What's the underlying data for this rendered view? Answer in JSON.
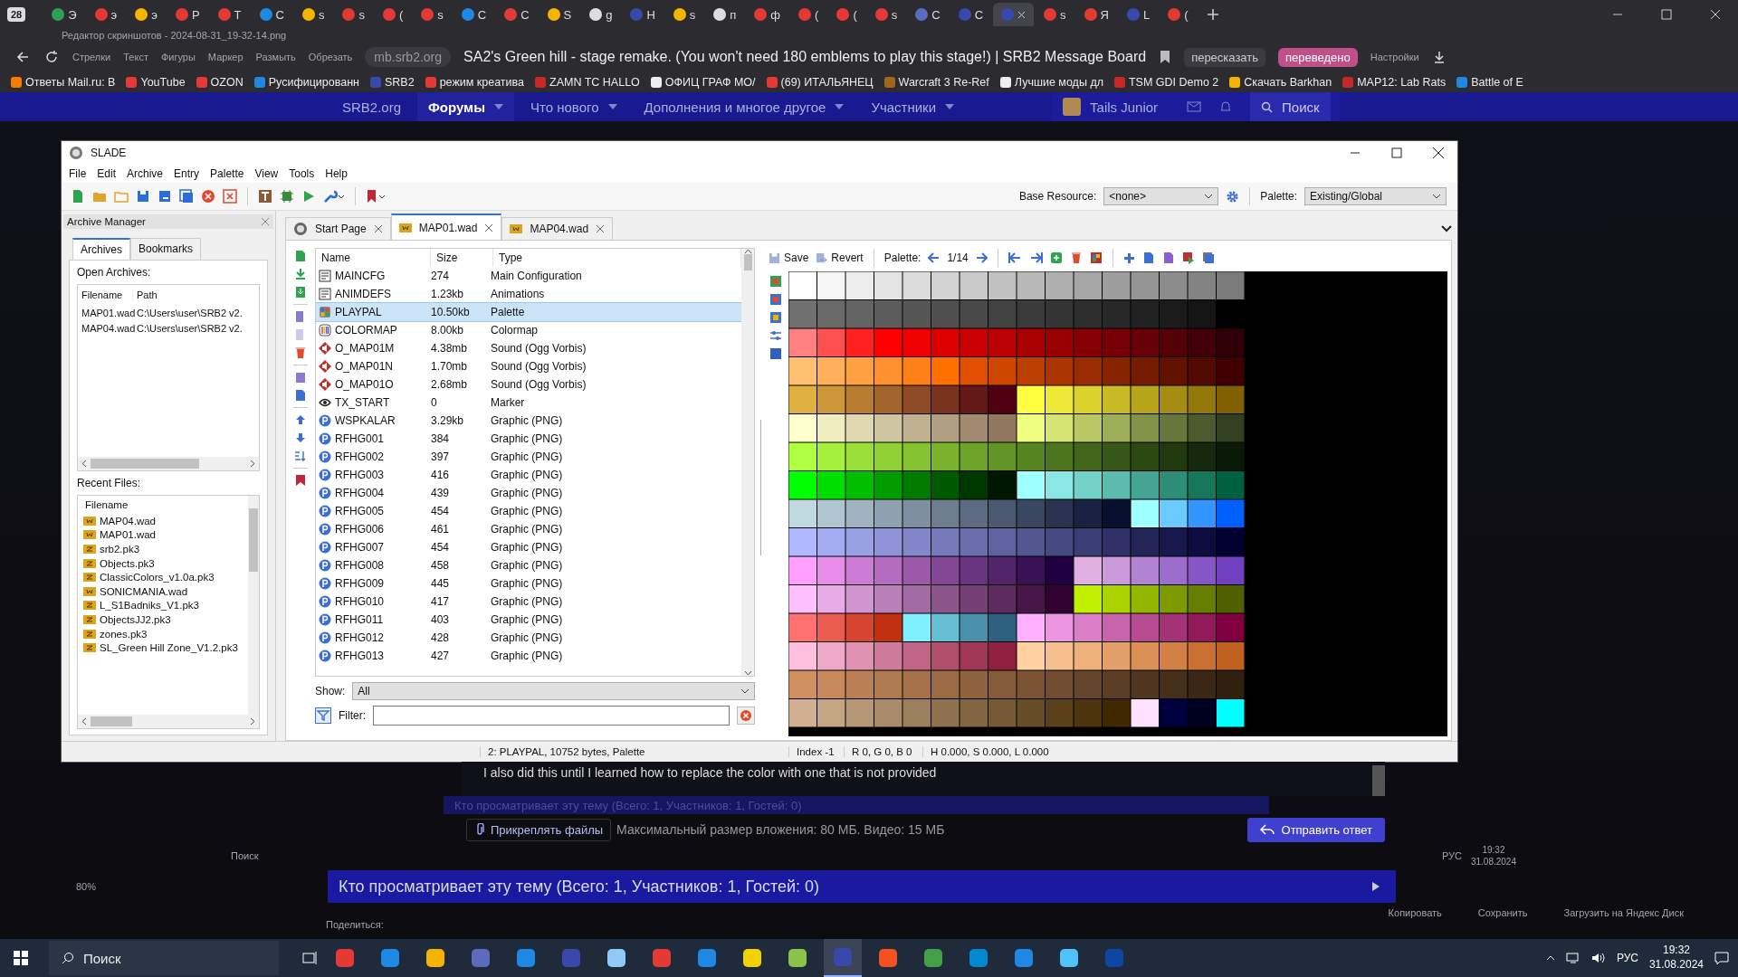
{
  "browser": {
    "tab_count": "28",
    "tabs": [
      {
        "label": "Э",
        "selected": false,
        "color": "#2e9e4f"
      },
      {
        "label": "э",
        "selected": false,
        "color": "#e53935"
      },
      {
        "label": "э",
        "selected": false,
        "color": "#f4b400"
      },
      {
        "label": "Р",
        "selected": false,
        "color": "#e53935"
      },
      {
        "label": "Т",
        "selected": false,
        "color": "#e53935"
      },
      {
        "label": "С",
        "selected": false,
        "color": "#1e88e5"
      },
      {
        "label": "s",
        "selected": false,
        "color": "#f4b400"
      },
      {
        "label": "s",
        "selected": false,
        "color": "#e53935"
      },
      {
        "label": "(",
        "selected": false,
        "color": "#e53935"
      },
      {
        "label": "s",
        "selected": false,
        "color": "#e53935"
      },
      {
        "label": "С",
        "selected": false,
        "color": "#1e88e5"
      },
      {
        "label": "С",
        "selected": false,
        "color": "#e53935"
      },
      {
        "label": "S",
        "selected": false,
        "color": "#f4b400"
      },
      {
        "label": "g",
        "selected": false,
        "color": "#dddddd"
      },
      {
        "label": "Н",
        "selected": false,
        "color": "#3949ab"
      },
      {
        "label": "s",
        "selected": false,
        "color": "#f4b400"
      },
      {
        "label": "п",
        "selected": false,
        "color": "#dddddd"
      },
      {
        "label": "ф",
        "selected": false,
        "color": "#e53935"
      },
      {
        "label": "(",
        "selected": false,
        "color": "#e53935"
      },
      {
        "label": "(",
        "selected": false,
        "color": "#e53935"
      },
      {
        "label": "s",
        "selected": false,
        "color": "#e53935"
      },
      {
        "label": "С",
        "selected": false,
        "color": "#5c6bc0"
      },
      {
        "label": "С",
        "selected": false,
        "color": "#3949ab"
      },
      {
        "selected": true,
        "color": "#3949ab"
      },
      {
        "label": "s",
        "selected": false,
        "color": "#e53935"
      },
      {
        "label": "Я",
        "selected": false,
        "color": "#e53935"
      },
      {
        "label": "L",
        "selected": false,
        "color": "#3949ab"
      },
      {
        "label": "(",
        "selected": false,
        "color": "#e53935"
      }
    ],
    "editor_title": "Редактор скриншотов - 2024-08-31_19-32-14.png",
    "editor_tools": [
      "Стрелки",
      "Текст",
      "Фигуры",
      "Маркер",
      "Размыть",
      "Обрезать"
    ],
    "editor_settings": "Настройки",
    "url": "mb.srb2.org",
    "page_title": "SA2's Green hill - stage remake. (You won't need 180 emblems to play this stage!) | SRB2 Message Board",
    "summarize": "пересказать",
    "translated": "переведено",
    "bookmarks": [
      {
        "label": "Ответы Mail.ru: B",
        "color": "#f57c00"
      },
      {
        "label": "YouTube",
        "color": "#e53935"
      },
      {
        "label": "OZON",
        "color": "#e53935"
      },
      {
        "label": "Русифицированн",
        "color": "#1e88e5"
      },
      {
        "label": "SRB2",
        "color": "#3949ab"
      },
      {
        "label": "режим креатива",
        "color": "#e53935"
      },
      {
        "label": "ZAMN TC HALLO",
        "color": "#c62828"
      },
      {
        "label": "ОФИЦ ГРАФ МО/",
        "color": "#eeeeee"
      },
      {
        "label": "(69) ИТАЛЬЯНЕЦ",
        "color": "#e53935"
      },
      {
        "label": "Warcraft 3 Re-Ref",
        "color": "#a1661a"
      },
      {
        "label": "Лучшие моды дл",
        "color": "#eeeeee"
      },
      {
        "label": "TSM GDI Demo 2",
        "color": "#c62828"
      },
      {
        "label": "Скачать Barkhan",
        "color": "#f4b400"
      },
      {
        "label": "MAP12: Lab Rats",
        "color": "#c62828"
      },
      {
        "label": "Battle of E",
        "color": "#1e88e5"
      }
    ]
  },
  "site_nav": {
    "items": [
      {
        "label": "SRB2.org",
        "selected": false,
        "menu": false
      },
      {
        "label": "Форумы",
        "selected": true,
        "menu": true
      },
      {
        "label": "Что нового",
        "selected": false,
        "menu": true
      },
      {
        "label": "Дополнения и многое другое",
        "selected": false,
        "menu": true
      },
      {
        "label": "Участники",
        "selected": false,
        "menu": true
      }
    ],
    "user": "Tails Junior",
    "search": "Поиск"
  },
  "slade": {
    "title": "SLADE",
    "menu": [
      "File",
      "Edit",
      "Archive",
      "Entry",
      "Palette",
      "View",
      "Tools",
      "Help"
    ],
    "base_resource_label": "Base Resource:",
    "base_resource": "<none>",
    "palette_label": "Palette:",
    "palette": "Existing/Global",
    "archive_manager": {
      "title": "Archive Manager",
      "tabs": [
        {
          "label": "Archives",
          "selected": true
        },
        {
          "label": "Bookmarks",
          "selected": false
        }
      ],
      "open_label": "Open Archives:",
      "open_columns": [
        "Filename",
        "Path"
      ],
      "open_rows": [
        [
          "MAP01.wad",
          "C:\\Users\\user\\SRB2 v2."
        ],
        [
          "MAP04.wad",
          "C:\\Users\\user\\SRB2 v2."
        ]
      ],
      "recent_label": "Recent Files:",
      "recent_column": "Filename",
      "recent": [
        {
          "name": "MAP04.wad",
          "kind": "wad"
        },
        {
          "name": "MAP01.wad",
          "kind": "wad"
        },
        {
          "name": "srb2.pk3",
          "kind": "zip"
        },
        {
          "name": "Objects.pk3",
          "kind": "zip"
        },
        {
          "name": "ClassicColors_v1.0a.pk3",
          "kind": "zip"
        },
        {
          "name": "SONICMANIA.wad",
          "kind": "wad"
        },
        {
          "name": "L_S1Badniks_V1.pk3",
          "kind": "zip"
        },
        {
          "name": "ObjectsJJ2.pk3",
          "kind": "zip"
        },
        {
          "name": "zones.pk3",
          "kind": "zip"
        },
        {
          "name": "SL_Green Hill Zone_V1.2.pk3",
          "kind": "zip"
        }
      ]
    },
    "doc_tabs": [
      {
        "label": "Start Page",
        "kind": "start",
        "selected": false
      },
      {
        "label": "MAP01.wad",
        "kind": "wad",
        "selected": true
      },
      {
        "label": "MAP04.wad",
        "kind": "wad",
        "selected": false
      }
    ],
    "entries": {
      "columns": [
        "Name",
        "Size",
        "Type"
      ],
      "rows": [
        {
          "name": "MAINCFG",
          "size": "274",
          "type": "Main Configuration",
          "kind": "text",
          "selected": false
        },
        {
          "name": "ANIMDEFS",
          "size": "1.23kb",
          "type": "Animations",
          "kind": "text",
          "selected": false
        },
        {
          "name": "PLAYPAL",
          "size": "10.50kb",
          "type": "Palette",
          "kind": "palette",
          "selected": true
        },
        {
          "name": "COLORMAP",
          "size": "8.00kb",
          "type": "Colormap",
          "kind": "colormap",
          "selected": false
        },
        {
          "name": "O_MAP01M",
          "size": "4.38mb",
          "type": "Sound (Ogg Vorbis)",
          "kind": "sound",
          "selected": false
        },
        {
          "name": "O_MAP01N",
          "size": "1.70mb",
          "type": "Sound (Ogg Vorbis)",
          "kind": "sound",
          "selected": false
        },
        {
          "name": "O_MAP01O",
          "size": "2.68mb",
          "type": "Sound (Ogg Vorbis)",
          "kind": "sound",
          "selected": false
        },
        {
          "name": "TX_START",
          "size": "0",
          "type": "Marker",
          "kind": "marker",
          "selected": false
        },
        {
          "name": "WSPKALAR",
          "size": "3.29kb",
          "type": "Graphic (PNG)",
          "kind": "png",
          "selected": false
        },
        {
          "name": "RFHG001",
          "size": "384",
          "type": "Graphic (PNG)",
          "kind": "png",
          "selected": false
        },
        {
          "name": "RFHG002",
          "size": "397",
          "type": "Graphic (PNG)",
          "kind": "png",
          "selected": false
        },
        {
          "name": "RFHG003",
          "size": "416",
          "type": "Graphic (PNG)",
          "kind": "png",
          "selected": false
        },
        {
          "name": "RFHG004",
          "size": "439",
          "type": "Graphic (PNG)",
          "kind": "png",
          "selected": false
        },
        {
          "name": "RFHG005",
          "size": "454",
          "type": "Graphic (PNG)",
          "kind": "png",
          "selected": false
        },
        {
          "name": "RFHG006",
          "size": "461",
          "type": "Graphic (PNG)",
          "kind": "png",
          "selected": false
        },
        {
          "name": "RFHG007",
          "size": "454",
          "type": "Graphic (PNG)",
          "kind": "png",
          "selected": false
        },
        {
          "name": "RFHG008",
          "size": "458",
          "type": "Graphic (PNG)",
          "kind": "png",
          "selected": false
        },
        {
          "name": "RFHG009",
          "size": "445",
          "type": "Graphic (PNG)",
          "kind": "png",
          "selected": false
        },
        {
          "name": "RFHG010",
          "size": "417",
          "type": "Graphic (PNG)",
          "kind": "png",
          "selected": false
        },
        {
          "name": "RFHG011",
          "size": "403",
          "type": "Graphic (PNG)",
          "kind": "png",
          "selected": false
        },
        {
          "name": "RFHG012",
          "size": "428",
          "type": "Graphic (PNG)",
          "kind": "png",
          "selected": false
        },
        {
          "name": "RFHG013",
          "size": "427",
          "type": "Graphic (PNG)",
          "kind": "png",
          "selected": false
        }
      ]
    },
    "show_label": "Show:",
    "show": "All",
    "filter_label": "Filter:",
    "palette_toolbar": {
      "save": "Save",
      "revert": "Revert",
      "label": "Palette:",
      "page": "1/14"
    },
    "status": [
      "2: PLAYPAL, 10752 bytes, Palette",
      "Index -1",
      "R 0, G 0, B 0",
      "H 0.000, S 0.000, L 0.000"
    ]
  },
  "forum": {
    "post_text": "I also did this until I learned how to replace the color with one that is not provided",
    "ghost_viewers": "Кто просматривает эту тему (Всего: 1, Участников: 1, Гостей: 0)",
    "attach": "Прикреплять файлы",
    "limits": "Максимальный размер вложения: 80 МБ. Видео: 15 МБ",
    "send": "Отправить ответ",
    "ghost_taskbar": {
      "search": "Поиск",
      "lang": "РУС",
      "time": "19:32",
      "date": "31.08.2024"
    },
    "viewers": "Кто просматривает эту тему (Всего: 1, Участников: 1, Гостей: 0)",
    "zoom": "80%",
    "editor_actions": [
      "Копировать",
      "Сохранить",
      "Загрузить на Яндекс Диск"
    ],
    "share": "Поделиться:"
  },
  "taskbar": {
    "search": "Поиск",
    "lang": "РУС",
    "time": "19:32",
    "date": "31.08.2024",
    "apps": [
      {
        "color": "#e53935",
        "selected": false
      },
      {
        "color": "#1e88e5",
        "selected": false
      },
      {
        "color": "#f4b400",
        "selected": false
      },
      {
        "color": "#5c6bc0",
        "selected": false
      },
      {
        "color": "#1e88e5",
        "selected": false
      },
      {
        "color": "#3949ab",
        "selected": false
      },
      {
        "color": "#90caf9",
        "selected": false
      },
      {
        "color": "#e53935",
        "selected": false
      },
      {
        "color": "#1e88e5",
        "selected": false
      },
      {
        "color": "#f4d100",
        "selected": false
      },
      {
        "color": "#8bc34a",
        "selected": false
      },
      {
        "color": "#3949ab",
        "selected": true
      },
      {
        "color": "#f4511e",
        "selected": false
      },
      {
        "color": "#43a047",
        "selected": false
      },
      {
        "color": "#0288d1",
        "selected": false
      },
      {
        "color": "#1e88e5",
        "selected": false
      },
      {
        "color": "#4fc3f7",
        "selected": false
      },
      {
        "color": "#0d47a1",
        "selected": false
      }
    ]
  }
}
